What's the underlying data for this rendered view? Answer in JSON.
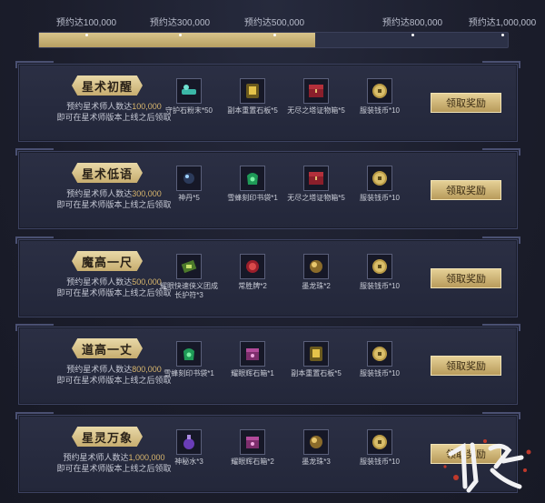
{
  "progress": {
    "fraction": 0.59,
    "milestones": [
      "预约达100,000",
      "预约达300,000",
      "预约达500,000",
      "预约达800,000",
      "预约达1,000,000"
    ]
  },
  "tiers": [
    {
      "title": "星术初醒",
      "desc_prefix": "预约星术师人数达",
      "target": "100,000",
      "desc_line2": "即可在星术师版本上线之后领取",
      "rewards": [
        {
          "label": "守护石粉末*50",
          "icon": "powder-icon"
        },
        {
          "label": "副本重置石板*5",
          "icon": "tablet-icon"
        },
        {
          "label": "无尽之塔证物箱*5",
          "icon": "chest-icon"
        },
        {
          "label": "服装钱币*10",
          "icon": "coin-icon"
        }
      ],
      "claim_label": "领取奖励"
    },
    {
      "title": "星术低语",
      "desc_prefix": "预约星术师人数达",
      "target": "300,000",
      "desc_line2": "即可在星术师版本上线之后领取",
      "rewards": [
        {
          "label": "神丹*5",
          "icon": "pill-icon"
        },
        {
          "label": "雪蜂刻印书袋*1",
          "icon": "pouch-icon"
        },
        {
          "label": "无尽之塔证物箱*5",
          "icon": "chest-icon"
        },
        {
          "label": "服装钱币*10",
          "icon": "coin-icon"
        }
      ],
      "claim_label": "领取奖励"
    },
    {
      "title": "魔高一尺",
      "desc_prefix": "预约星术师人数达",
      "target": "500,000",
      "desc_line2": "即可在星术师版本上线之后领取",
      "rewards": [
        {
          "label": "耀眼快速侠义团成长护符*3",
          "icon": "charm-icon"
        },
        {
          "label": "常胜牌*2",
          "icon": "token-icon"
        },
        {
          "label": "墨龙珠*2",
          "icon": "orb-icon"
        },
        {
          "label": "服装钱币*10",
          "icon": "coin-icon"
        }
      ],
      "claim_label": "领取奖励"
    },
    {
      "title": "道高一丈",
      "desc_prefix": "预约星术师人数达",
      "target": "800,000",
      "desc_line2": "即可在星术师版本上线之后领取",
      "rewards": [
        {
          "label": "雪蜂刻印书袋*1",
          "icon": "pouch-icon"
        },
        {
          "label": "耀眼辉石箱*1",
          "icon": "gem-box-icon"
        },
        {
          "label": "副本重置石板*5",
          "icon": "tablet-icon"
        },
        {
          "label": "服装钱币*10",
          "icon": "coin-icon"
        }
      ],
      "claim_label": "领取奖励"
    },
    {
      "title": "星灵万象",
      "desc_prefix": "预约星术师人数达",
      "target": "1,000,000",
      "desc_line2": "即可在星术师版本上线之后领取",
      "rewards": [
        {
          "label": "神秘水*3",
          "icon": "potion-icon"
        },
        {
          "label": "耀眼辉石箱*2",
          "icon": "gem-box-icon"
        },
        {
          "label": "墨龙珠*3",
          "icon": "orb-icon"
        },
        {
          "label": "服装钱币*10",
          "icon": "coin-icon"
        }
      ],
      "claim_label": "领取奖励"
    }
  ],
  "colors": {
    "accent": "#d7b56d",
    "panel": "#2b2f44"
  }
}
